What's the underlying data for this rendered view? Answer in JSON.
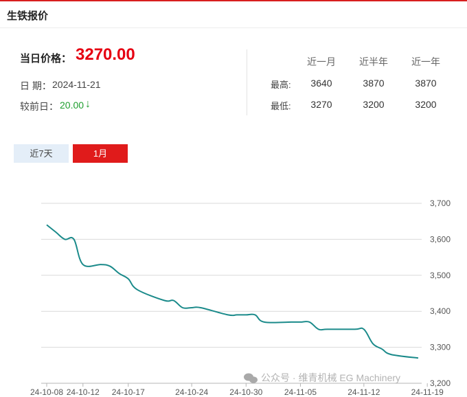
{
  "panel": {
    "title": "生铁报价"
  },
  "summary": {
    "price_label": "当日价格：",
    "price": "3270.00",
    "date_label": "日 期：",
    "date": "2024-11-21",
    "compare_label": "较前日：",
    "compare_value": "20.00",
    "compare_arrow": "↓"
  },
  "stats": {
    "columns": [
      "近一月",
      "近半年",
      "近一年"
    ],
    "rows": [
      {
        "label": "最高:",
        "values": [
          "3640",
          "3870",
          "3870"
        ]
      },
      {
        "label": "最低:",
        "values": [
          "3270",
          "3200",
          "3200"
        ]
      }
    ]
  },
  "tabs": [
    {
      "label": "近7天",
      "active": false
    },
    {
      "label": "1月",
      "active": true
    }
  ],
  "watermark": "公众号 · 维青机械 EG Machinery",
  "colors": {
    "accent": "#e01b1b",
    "price": "#e60012",
    "down": "#1e9e2e",
    "line": "#1a8a8a",
    "tab_inactive": "#e4eef8"
  },
  "chart_data": {
    "type": "line",
    "title": "",
    "xlabel": "",
    "ylabel": "",
    "ylim": [
      3200,
      3700
    ],
    "yticks": [
      "3,200",
      "3,300",
      "3,400",
      "3,500",
      "3,600",
      "3,700"
    ],
    "ytick_values": [
      3200,
      3300,
      3400,
      3500,
      3600,
      3700
    ],
    "xticks": [
      "24-10-08",
      "24-10-12",
      "24-10-17",
      "24-10-24",
      "24-10-30",
      "24-11-05",
      "24-11-12",
      "24-11-19"
    ],
    "grid": true,
    "series": [
      {
        "points": [
          [
            "24-10-08",
            3640
          ],
          [
            "24-10-09",
            3620
          ],
          [
            "24-10-10",
            3600
          ],
          [
            "24-10-11",
            3600
          ],
          [
            "24-10-12",
            3530
          ],
          [
            "24-10-14",
            3530
          ],
          [
            "24-10-15",
            3525
          ],
          [
            "24-10-16",
            3505
          ],
          [
            "24-10-17",
            3490
          ],
          [
            "24-10-18",
            3460
          ],
          [
            "24-10-21",
            3430
          ],
          [
            "24-10-22",
            3430
          ],
          [
            "24-10-23",
            3410
          ],
          [
            "24-10-24",
            3410
          ],
          [
            "24-10-25",
            3410
          ],
          [
            "24-10-28",
            3390
          ],
          [
            "24-10-29",
            3390
          ],
          [
            "24-10-30",
            3390
          ],
          [
            "24-10-31",
            3390
          ],
          [
            "24-11-01",
            3370
          ],
          [
            "24-11-04",
            3370
          ],
          [
            "24-11-05",
            3370
          ],
          [
            "24-11-06",
            3370
          ],
          [
            "24-11-07",
            3350
          ],
          [
            "24-11-08",
            3350
          ],
          [
            "24-11-11",
            3350
          ],
          [
            "24-11-12",
            3350
          ],
          [
            "24-11-13",
            3310
          ],
          [
            "24-11-14",
            3295
          ],
          [
            "24-11-15",
            3280
          ],
          [
            "24-11-18",
            3270
          ]
        ]
      }
    ]
  }
}
